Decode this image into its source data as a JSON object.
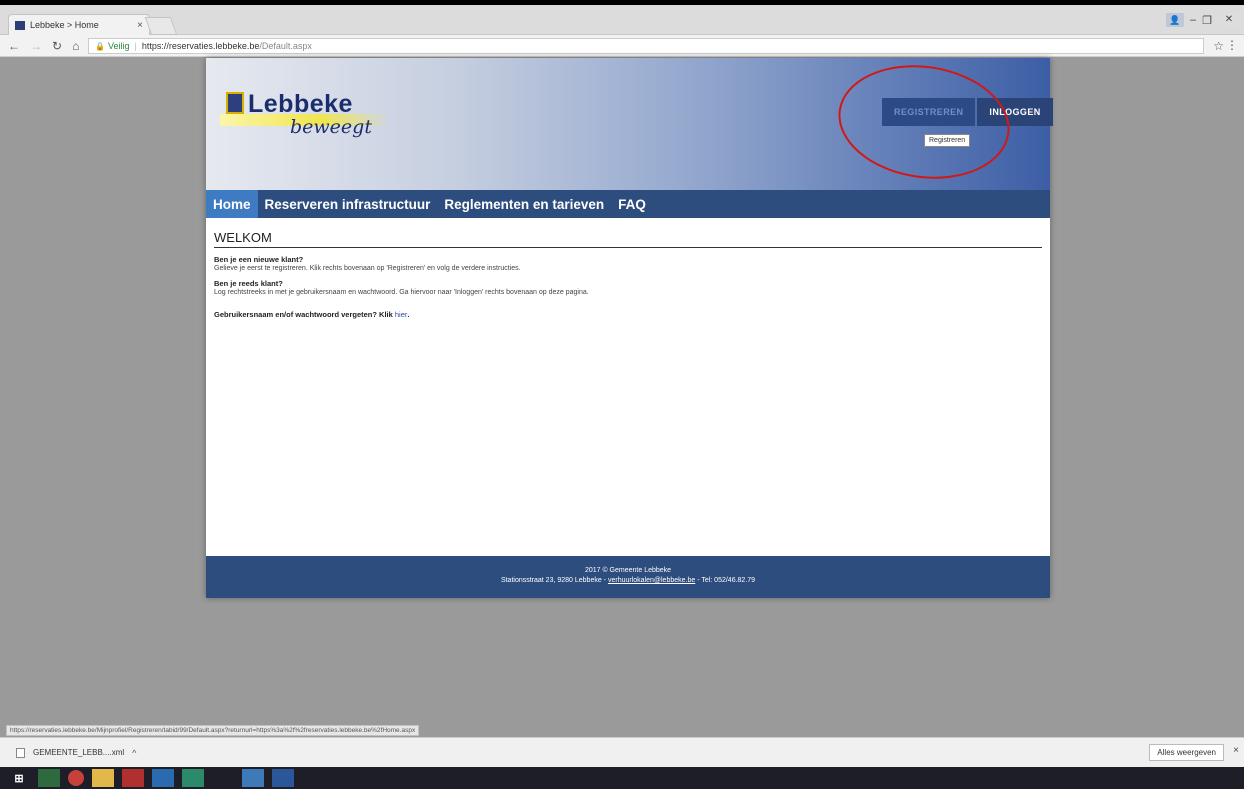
{
  "browser": {
    "tab_title": "Lebbeke > Home",
    "tab_close": "×",
    "secure_label": "Veilig",
    "url_host": "https://reservaties.lebbeke.be",
    "url_path": "/Default.aspx",
    "status_url": "https://reservaties.lebbeke.be/Mijnprofiel/Registreren/tabid/99/Default.aspx?returnurl=https%3a%2f%2freservaties.lebbeke.be%2fHome.aspx"
  },
  "site": {
    "logo_name": "Lebbeke",
    "logo_sub": "beweegt",
    "auth": {
      "register": "REGISTREREN",
      "login": "INLOGGEN",
      "tooltip": "Registreren"
    },
    "menu": [
      {
        "label": "Home",
        "active": true
      },
      {
        "label": "Reserveren infrastructuur",
        "active": false
      },
      {
        "label": "Reglementen en tarieven",
        "active": false
      },
      {
        "label": "FAQ",
        "active": false
      }
    ],
    "content": {
      "title": "WELKOM",
      "q1": "Ben je een nieuwe klant?",
      "p1": "Gelieve je eerst te registreren. Klik rechts bovenaan op 'Registreren' en volg de verdere instructies.",
      "q2": "Ben je reeds klant?",
      "p2": "Log rechtstreeks in met je gebruikersnaam en wachtwoord. Ga hiervoor naar 'Inloggen' rechts bovenaan op deze pagina.",
      "forgot": "Gebruikersnaam en/of wachtwoord vergeten? Klik ",
      "forgot_link": "hier",
      "forgot_end": "."
    },
    "footer": {
      "line1": "2017 © Gemeente Lebbeke",
      "address": "Stationsstraat 23, 9280 Lebbeke  - ",
      "email": "verhuurlokalen@lebbeke.be",
      "phone": " - Tel: 052/46.82.79"
    }
  },
  "downloads": {
    "file": "GEMEENTE_LEBB....xml",
    "show_all": "Alles weergeven",
    "close": "×"
  },
  "colors": {
    "header_dark": "#3c5ea6",
    "menu_bg": "#2c4d7e",
    "menu_active": "#3e7bc2",
    "annotation_circle": "#d01818"
  }
}
